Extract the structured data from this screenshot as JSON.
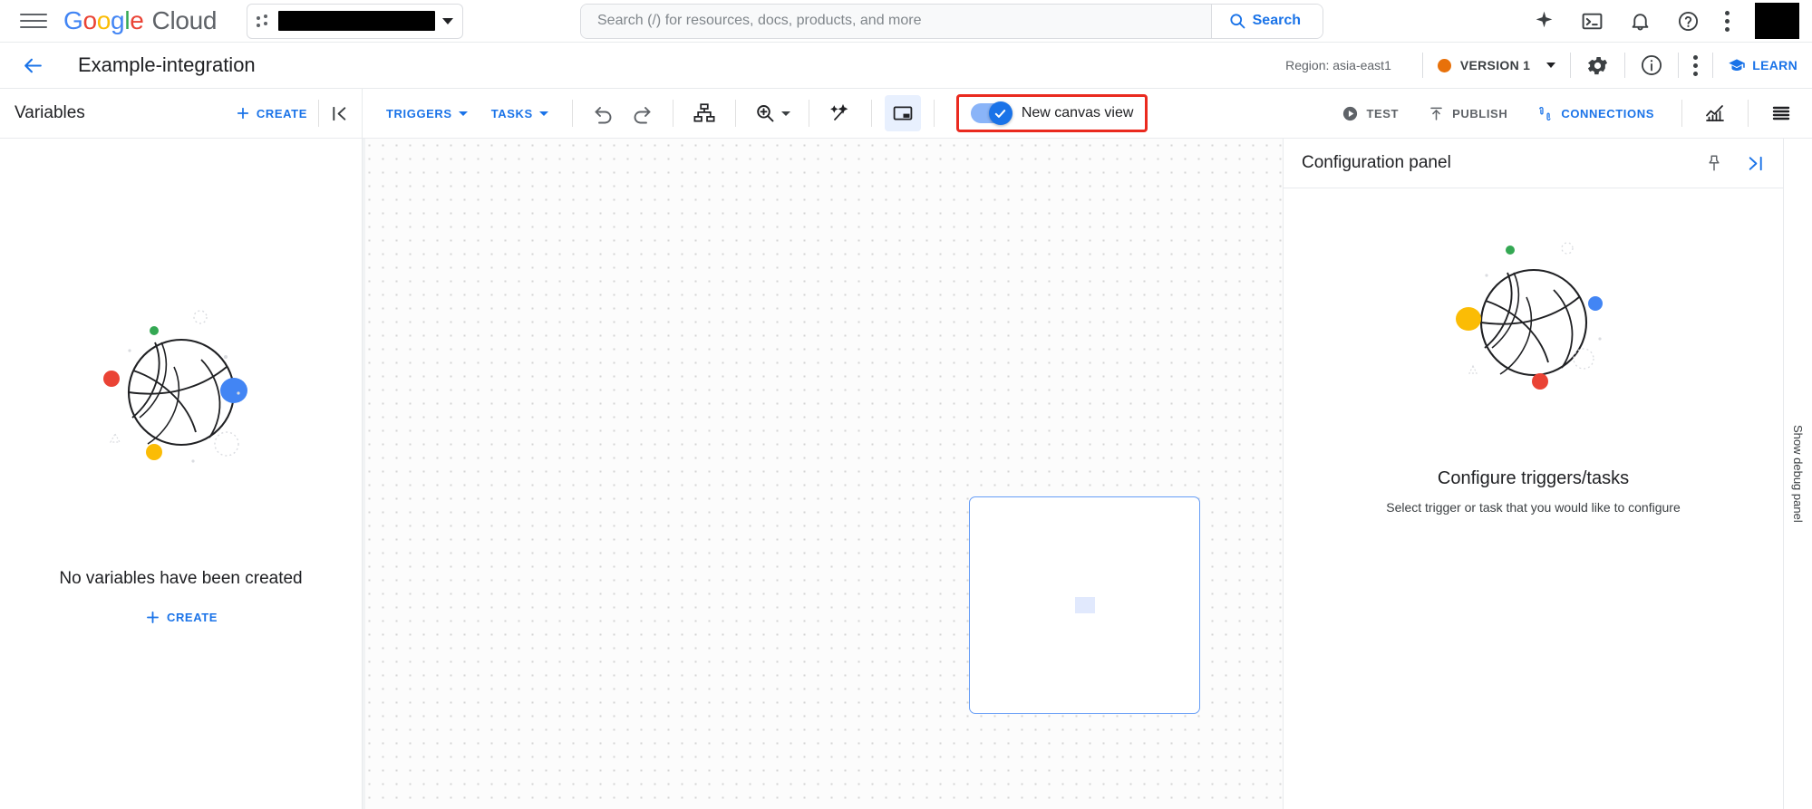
{
  "topbar": {
    "menu_icon": "hamburger-menu-icon",
    "brand": {
      "g1": "G",
      "g2": "o",
      "g3": "o",
      "g4": "g",
      "g5": "l",
      "g6": "e",
      "cloud": "Cloud"
    },
    "project_selector": {
      "icon": "project-dots-icon",
      "value": "",
      "caret": "chevron-down-icon"
    },
    "search": {
      "placeholder": "Search (/) for resources, docs, products, and more",
      "value": "",
      "button_label": "Search",
      "button_icon": "search-icon"
    },
    "icons": [
      "gemini-spark-icon",
      "cloud-shell-terminal-icon",
      "notifications-bell-icon",
      "help-question-icon",
      "more-kebab-icon",
      "avatar"
    ]
  },
  "subheader": {
    "back_icon": "back-arrow-icon",
    "title": "Example-integration",
    "region": "Region: asia-east1",
    "version": {
      "label": "VERSION 1",
      "status_color": "#E8710A",
      "caret": "chevron-down-icon"
    },
    "settings_icon": "gear-icon",
    "info_icon": "info-circle-icon",
    "more_icon": "more-kebab-icon",
    "learn": {
      "label": "LEARN",
      "icon": "school-graduation-cap-icon"
    }
  },
  "toolbar": {
    "variables_title": "Variables",
    "variables_create": "CREATE",
    "collapse_icon": "collapse-panel-left-icon",
    "triggers": "TRIGGERS",
    "tasks": "TASKS",
    "undo_icon": "undo-icon",
    "redo_icon": "redo-icon",
    "layout_icon": "auto-layout-hierarchy-icon",
    "zoom_icon": "zoom-in-icon",
    "magic_icon": "magic-wand-icon",
    "panel_icon": "toggle-panel-icon",
    "canvas_toggle": {
      "label": "New canvas view",
      "checked": true,
      "highlight_color": "#ea2a1f"
    },
    "test": "TEST",
    "publish": "PUBLISH",
    "connections": "CONNECTIONS",
    "analytics_icon": "analytics-chart-icon",
    "logs_icon": "logs-list-icon"
  },
  "left_panel": {
    "empty_message": "No variables have been created",
    "create_label": "CREATE",
    "illustration": "empty-state-globe-illustration"
  },
  "canvas": {
    "node_card": "canvas-node-card"
  },
  "config_panel": {
    "title": "Configuration panel",
    "pin_icon": "pin-icon",
    "expand_icon": "collapse-panel-right-icon",
    "empty_title": "Configure triggers/tasks",
    "empty_subtitle": "Select trigger or task that you would like to configure",
    "illustration": "empty-state-globe-illustration"
  },
  "debug_panel": {
    "label": "Show debug panel"
  },
  "colors": {
    "blue": "#1a73e8",
    "light_blue": "#8ab4f8",
    "red": "#EA4335",
    "yellow": "#FBBC05",
    "green": "#34A853",
    "orange": "#E8710A",
    "highlight_red": "#ea2a1f"
  }
}
